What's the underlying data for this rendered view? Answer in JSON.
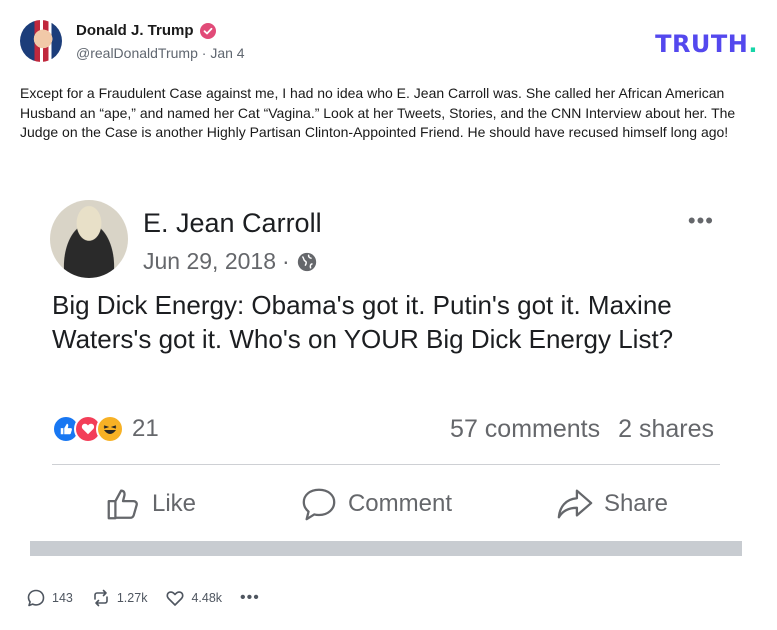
{
  "author": {
    "name": "Donald J. Trump",
    "handle": "@realDonaldTrump",
    "separator": "·",
    "date": "Jan 4",
    "verified_color": "#e14b78"
  },
  "brand": {
    "logo_text": "TRUTH",
    "logo_dot": ".",
    "logo_color": "#5448ee",
    "dot_color": "#17d5a8"
  },
  "post": {
    "text": "Except for a Fraudulent Case against me, I had no idea who E. Jean Carroll was. She called her African American Husband an “ape,” and named her Cat “Vagina.” Look at her Tweets, Stories, and the CNN Interview about her. The Judge on the Case is another Highly Partisan Clinton-Appointed Friend. He should have recused himself long ago!"
  },
  "embedded_post": {
    "name": "E. Jean Carroll",
    "date": "Jun 29, 2018",
    "date_separator": "·",
    "privacy_icon": "globe-icon",
    "more_icon": "•••",
    "body": "Big Dick Energy: Obama's got it. Putin's got it. Maxine Waters's got it. Who's on YOUR Big Dick Energy List?",
    "reaction_count": "21",
    "comments": "57 comments",
    "shares": "2 shares",
    "actions": {
      "like": "Like",
      "comment": "Comment",
      "share": "Share"
    }
  },
  "footer": {
    "replies": "143",
    "retruths": "1.27k",
    "likes": "4.48k",
    "more": "•••"
  }
}
